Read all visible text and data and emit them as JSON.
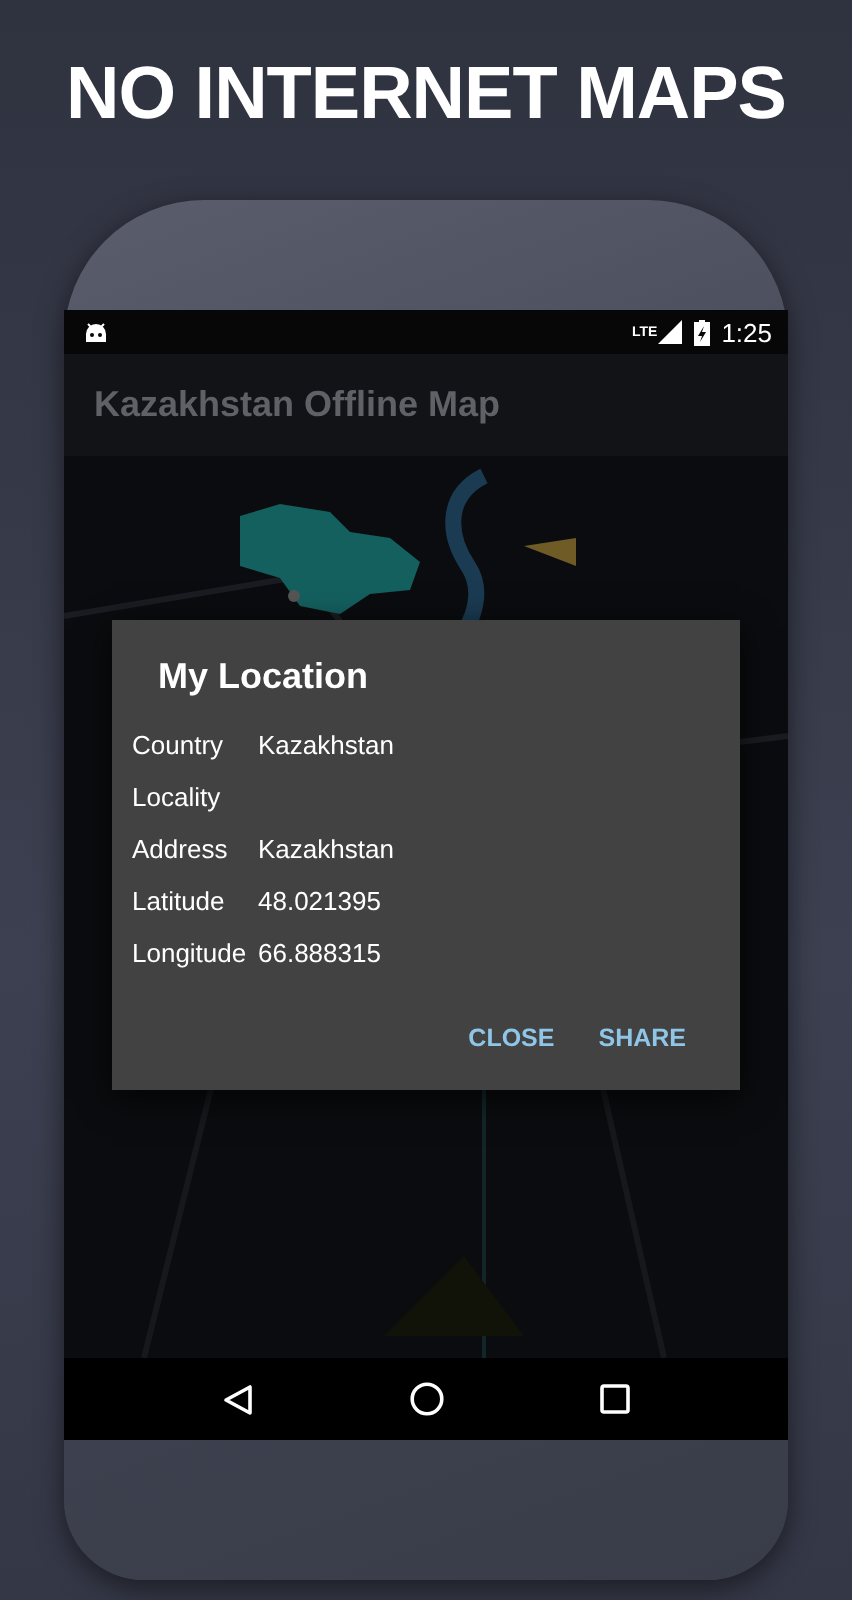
{
  "headline": "NO INTERNET MAPS",
  "status_bar": {
    "network": "LTE",
    "time": "1:25"
  },
  "app_bar": {
    "title": "Kazakhstan Offline Map"
  },
  "dialog": {
    "title": "My Location",
    "rows": [
      {
        "label": "Country",
        "value": "Kazakhstan"
      },
      {
        "label": "Locality"
      },
      {
        "label": "Address",
        "value": "Kazakhstan"
      },
      {
        "label": "Latitude",
        "value": "48.021395"
      },
      {
        "label": "Longitude",
        "value": "66.888315"
      }
    ],
    "buttons": [
      "CLOSE",
      "SHARE"
    ]
  }
}
